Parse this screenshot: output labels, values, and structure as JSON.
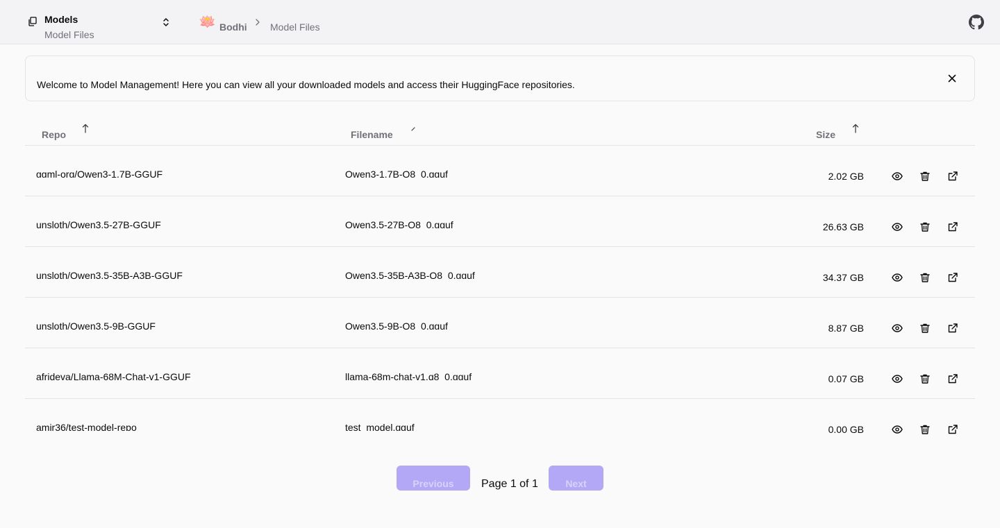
{
  "header": {
    "nav_title": "Models",
    "nav_subtitle": "Model Files",
    "breadcrumb_home": "Bodhi",
    "breadcrumb_current": "Model Files",
    "logo_glyph": "🪷"
  },
  "banner": {
    "text": "Welcome to Model Management! Here you can view all your downloaded models and access their HuggingFace repositories."
  },
  "table": {
    "columns": [
      "Repo",
      "Filename",
      "Size"
    ],
    "rows": [
      {
        "repo": "ggml-org/Qwen3-1.7B-GGUF",
        "filename": "Qwen3-1.7B-Q8_0.gguf",
        "size": "2.02 GB"
      },
      {
        "repo": "unsloth/Qwen3.5-27B-GGUF",
        "filename": "Qwen3.5-27B-Q8_0.gguf",
        "size": "26.63 GB"
      },
      {
        "repo": "unsloth/Qwen3.5-35B-A3B-GGUF",
        "filename": "Qwen3.5-35B-A3B-Q8_0.gguf",
        "size": "34.37 GB"
      },
      {
        "repo": "unsloth/Qwen3.5-9B-GGUF",
        "filename": "Qwen3.5-9B-Q8_0.gguf",
        "size": "8.87 GB"
      },
      {
        "repo": "afrideva/Llama-68M-Chat-v1-GGUF",
        "filename": "llama-68m-chat-v1.q8_0.gguf",
        "size": "0.07 GB"
      },
      {
        "repo": "amir36/test-model-repo",
        "filename": "test_model.gguf",
        "size": "0.00 GB"
      }
    ]
  },
  "pagination": {
    "previous_label": "Previous",
    "next_label": "Next",
    "page_info": "Page 1 of 1"
  },
  "colors": {
    "accent_disabled": "#b3a8f5",
    "border": "#e4e4e7",
    "muted_text": "#71717a"
  },
  "icons": [
    "files-icon",
    "chevrons-up-down-icon",
    "chevron-right-icon",
    "github-icon",
    "close-icon",
    "arrow-up-icon",
    "eye-icon",
    "trash-icon",
    "external-link-icon"
  ]
}
